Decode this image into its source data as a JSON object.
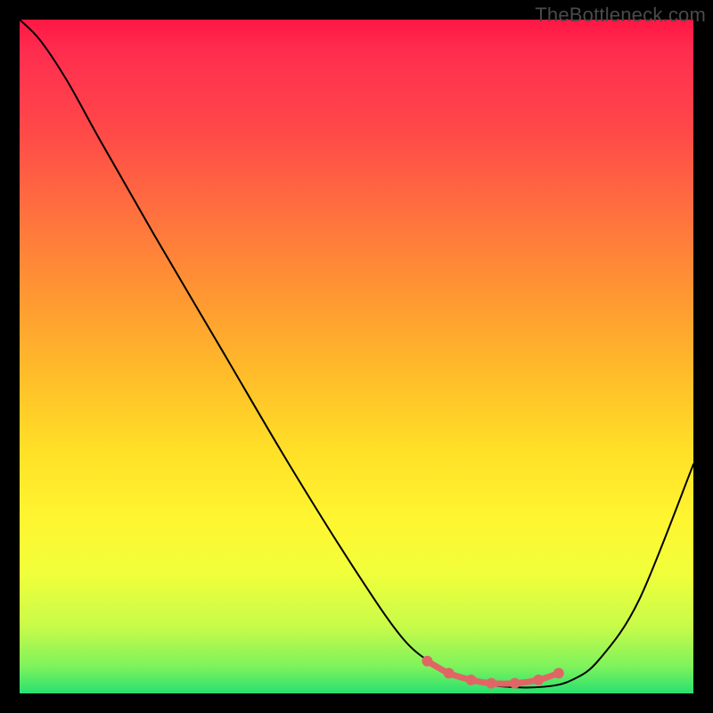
{
  "watermark": "TheBottleneck.com",
  "chart_data": {
    "type": "line",
    "title": "",
    "xlabel": "",
    "ylabel": "",
    "xlim": [
      0,
      1
    ],
    "ylim": [
      0,
      1
    ],
    "grid": false,
    "series": [
      {
        "name": "curve",
        "x": [
          0.0,
          0.03,
          0.07,
          0.12,
          0.2,
          0.3,
          0.4,
          0.5,
          0.57,
          0.62,
          0.66,
          0.72,
          0.78,
          0.82,
          0.86,
          0.92,
          1.0
        ],
        "y": [
          1.0,
          0.97,
          0.91,
          0.82,
          0.68,
          0.51,
          0.34,
          0.18,
          0.08,
          0.04,
          0.02,
          0.01,
          0.01,
          0.02,
          0.05,
          0.14,
          0.34
        ]
      }
    ],
    "markers": {
      "name": "highlight",
      "x": [
        0.605,
        0.637,
        0.67,
        0.7,
        0.735,
        0.77,
        0.8
      ],
      "y": [
        0.048,
        0.03,
        0.02,
        0.015,
        0.015,
        0.02,
        0.03
      ],
      "color": "#e06666"
    },
    "background_gradient": {
      "stops": [
        {
          "pos": 0.0,
          "color": "#ff1744"
        },
        {
          "pos": 0.05,
          "color": "#ff2e4f"
        },
        {
          "pos": 0.16,
          "color": "#ff4749"
        },
        {
          "pos": 0.28,
          "color": "#ff6e3f"
        },
        {
          "pos": 0.4,
          "color": "#ff9433"
        },
        {
          "pos": 0.52,
          "color": "#ffba2a"
        },
        {
          "pos": 0.64,
          "color": "#ffe027"
        },
        {
          "pos": 0.74,
          "color": "#fff530"
        },
        {
          "pos": 0.82,
          "color": "#f1ff3a"
        },
        {
          "pos": 0.9,
          "color": "#c8fb49"
        },
        {
          "pos": 0.96,
          "color": "#7ef35c"
        },
        {
          "pos": 1.0,
          "color": "#28e070"
        }
      ],
      "direction": "top-to-bottom"
    }
  }
}
